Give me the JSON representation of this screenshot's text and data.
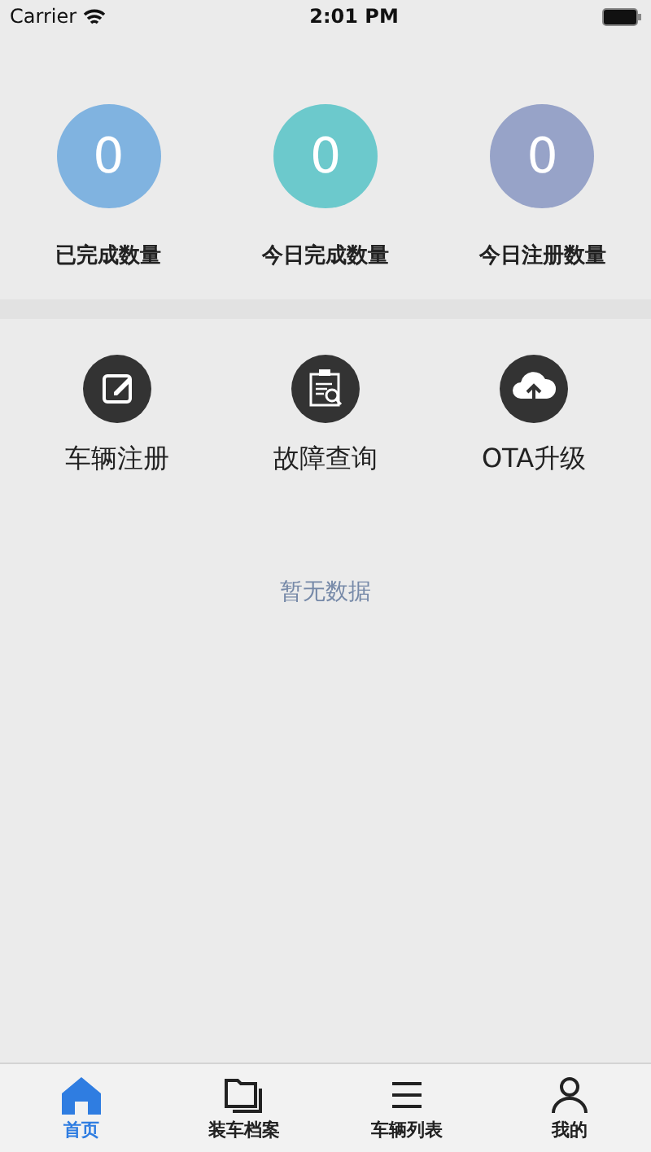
{
  "status_bar": {
    "carrier": "Carrier",
    "time": "2:01 PM"
  },
  "stats": [
    {
      "value": "0",
      "label": "已完成数量",
      "color": "#80b3e0"
    },
    {
      "value": "0",
      "label": "今日完成数量",
      "color": "#6cc9cc"
    },
    {
      "value": "0",
      "label": "今日注册数量",
      "color": "#97a3c8"
    }
  ],
  "actions": [
    {
      "kind": "edit",
      "label": "车辆注册"
    },
    {
      "kind": "clipboard",
      "label": "故障查询"
    },
    {
      "kind": "upload",
      "label": "OTA升级"
    }
  ],
  "empty_message": "暂无数据",
  "tabs": [
    {
      "kind": "home",
      "label": "首页",
      "selected": true
    },
    {
      "kind": "folder",
      "label": "装车档案",
      "selected": false
    },
    {
      "kind": "list",
      "label": "车辆列表",
      "selected": false
    },
    {
      "kind": "person",
      "label": "我的",
      "selected": false
    }
  ]
}
